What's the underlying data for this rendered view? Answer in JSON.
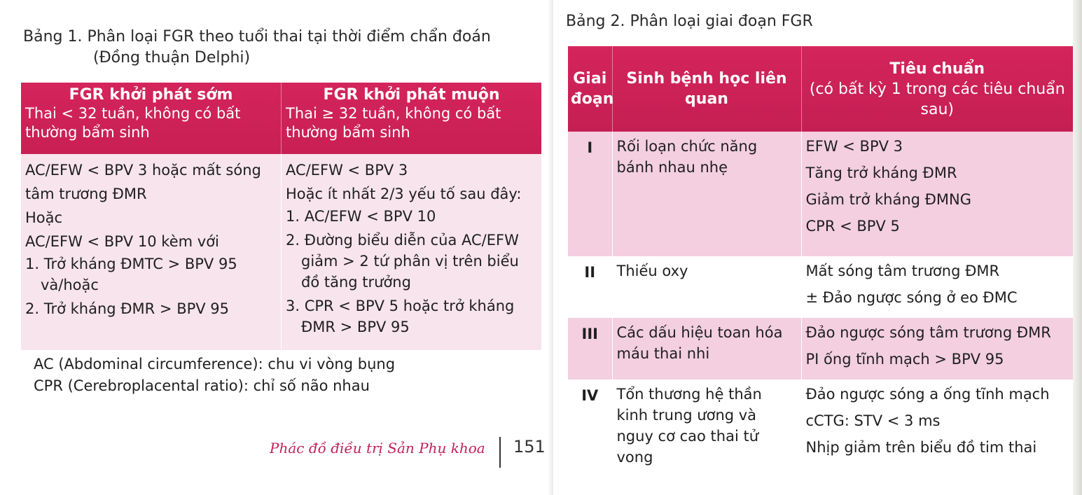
{
  "table1": {
    "title_line1": "Bảng 1. Phân loại FGR theo tuổi thai tại thời điểm chẩn đoán",
    "title_line2": "(Đồng thuận Delphi)",
    "col1": {
      "heading": "FGR khởi phát sớm",
      "subheading": "Thai < 32 tuần, không có bất thường bẩm sinh",
      "lines": [
        "AC/EFW < BPV 3 hoặc mất sóng tâm trương ĐMR",
        "Hoặc",
        "AC/EFW < BPV 10 kèm với"
      ],
      "items": [
        "1. Trở kháng ĐMTC > BPV 95 và/hoặc",
        "2. Trở kháng ĐMR > BPV 95"
      ]
    },
    "col2": {
      "heading": "FGR khởi phát muộn",
      "subheading": "Thai ≥ 32 tuần, không có bất thường bẩm sinh",
      "lines": [
        "AC/EFW < BPV 3",
        "Hoặc ít nhất 2/3 yếu tố sau đây:"
      ],
      "items": [
        "1. AC/EFW < BPV 10",
        "2. Đường biểu diễn của AC/EFW giảm > 2 tứ phân vị trên biểu đồ tăng trưởng",
        "3. CPR < BPV 5 hoặc trở kháng ĐMR > BPV 95"
      ]
    },
    "notes": [
      "AC (Abdominal circumference): chu vi vòng bụng",
      "CPR (Cerebroplacental ratio): chỉ số não nhau"
    ]
  },
  "footer": {
    "book_title": "Phác đồ điều trị Sản Phụ khoa",
    "page_number": "151"
  },
  "table2": {
    "title": "Bảng 2. Phân loại giai đoạn FGR",
    "headers": {
      "stage": "Giai đoạn",
      "patho": "Sinh bệnh học liên quan",
      "criteria": "Tiêu chuẩn",
      "criteria_sub": "(có bất kỳ 1 trong các tiêu chuẩn sau)"
    },
    "rows": [
      {
        "stage": "I",
        "patho": "Rối loạn chức năng bánh nhau nhẹ",
        "criteria": [
          "EFW < BPV 3",
          "Tăng trở kháng ĐMR",
          "Giảm trở kháng ĐMNG",
          "CPR < BPV 5"
        ]
      },
      {
        "stage": "II",
        "patho": "Thiếu oxy",
        "criteria": [
          "Mất sóng tâm trương ĐMR",
          "± Đảo ngược sóng ở eo ĐMC"
        ]
      },
      {
        "stage": "III",
        "patho": "Các dấu hiệu toan hóa máu thai nhi",
        "criteria": [
          "Đảo ngược sóng tâm trương ĐMR",
          "PI ống tĩnh mạch > BPV 95"
        ]
      },
      {
        "stage": "IV",
        "patho": "Tổn thương hệ thần kinh trung ương và nguy cơ cao thai tử vong",
        "criteria": [
          "Đảo ngược sóng a ống tĩnh mạch",
          "cCTG: STV < 3 ms",
          "Nhịp giảm trên biểu đồ tim thai"
        ]
      }
    ]
  },
  "colors": {
    "header_magenta": "#c81f55",
    "row_pink": "#f3cfe0",
    "cell_pink_light": "#f7e4ec",
    "footer_magenta": "#c02257"
  }
}
